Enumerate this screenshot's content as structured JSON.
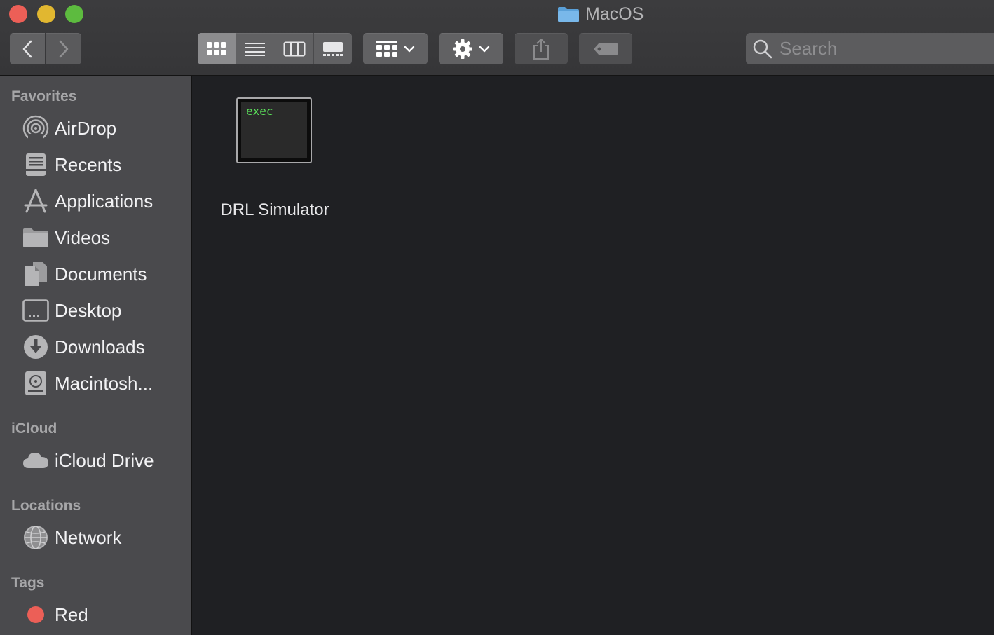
{
  "window": {
    "title": "MacOS"
  },
  "toolbar": {
    "back": "chevron-left-icon",
    "forward": "chevron-right-icon",
    "view_modes": [
      "icon-view",
      "list-view",
      "column-view",
      "gallery-view"
    ],
    "active_view": "icon-view",
    "search_placeholder": "Search"
  },
  "sidebar": {
    "favorites_title": "Favorites",
    "favorites": [
      {
        "label": "AirDrop",
        "icon": "airdrop-icon"
      },
      {
        "label": "Recents",
        "icon": "recents-icon"
      },
      {
        "label": "Applications",
        "icon": "applications-icon"
      },
      {
        "label": "Videos",
        "icon": "folder-icon"
      },
      {
        "label": "Documents",
        "icon": "documents-icon"
      },
      {
        "label": "Desktop",
        "icon": "desktop-icon"
      },
      {
        "label": "Downloads",
        "icon": "downloads-icon"
      },
      {
        "label": "Macintosh...",
        "icon": "hard-drive-icon"
      }
    ],
    "icloud_title": "iCloud",
    "icloud": [
      {
        "label": "iCloud Drive",
        "icon": "cloud-icon"
      }
    ],
    "locations_title": "Locations",
    "locations": [
      {
        "label": "Network",
        "icon": "network-globe-icon"
      }
    ],
    "tags_title": "Tags",
    "tags": [
      {
        "label": "Red",
        "color": "#ec5f57"
      }
    ]
  },
  "files": [
    {
      "name": "DRL Simulator",
      "icon_text": "exec",
      "kind": "unix-executable"
    }
  ],
  "colors": {
    "close": "#ec5f57",
    "minimize": "#e1b730",
    "maximize": "#5dbb3f",
    "exec_text": "#5be35b"
  }
}
